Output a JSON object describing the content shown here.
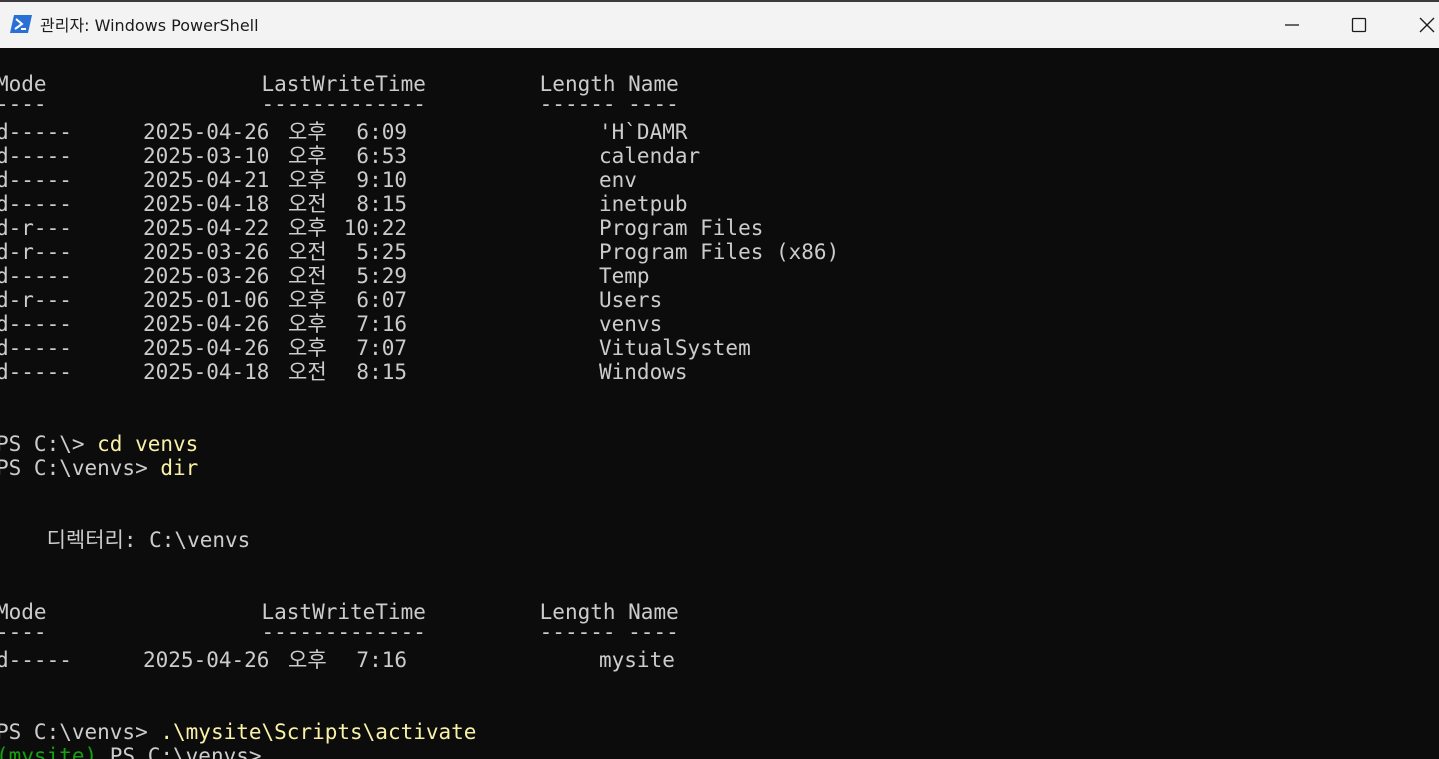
{
  "window": {
    "title": "관리자: Windows PowerShell",
    "icon": "powershell-icon",
    "controls": [
      "minimize-icon",
      "maximize-icon",
      "close-icon"
    ]
  },
  "colors": {
    "background": "#0c0c0c",
    "text": "#cccccc",
    "command": "#f9f1a5",
    "venv_prefix": "#13a10e",
    "titlebar": "#f3f3f3"
  },
  "terminal": {
    "listing1": {
      "header": "Mode                 LastWriteTime         Length Name",
      "underline": "----                 -------------         ------ ----",
      "rows": [
        {
          "mode": "d-----",
          "date": "2025-04-26",
          "ampm": "오후",
          "time": "6:09",
          "name": "'H`DAMR"
        },
        {
          "mode": "d-----",
          "date": "2025-03-10",
          "ampm": "오후",
          "time": "6:53",
          "name": "calendar"
        },
        {
          "mode": "d-----",
          "date": "2025-04-21",
          "ampm": "오후",
          "time": "9:10",
          "name": "env"
        },
        {
          "mode": "d-----",
          "date": "2025-04-18",
          "ampm": "오전",
          "time": "8:15",
          "name": "inetpub"
        },
        {
          "mode": "d-r---",
          "date": "2025-04-22",
          "ampm": "오후",
          "time": "10:22",
          "name": "Program Files"
        },
        {
          "mode": "d-r---",
          "date": "2025-03-26",
          "ampm": "오전",
          "time": "5:25",
          "name": "Program Files (x86)"
        },
        {
          "mode": "d-----",
          "date": "2025-03-26",
          "ampm": "오전",
          "time": "5:29",
          "name": "Temp"
        },
        {
          "mode": "d-r---",
          "date": "2025-01-06",
          "ampm": "오후",
          "time": "6:07",
          "name": "Users"
        },
        {
          "mode": "d-----",
          "date": "2025-04-26",
          "ampm": "오후",
          "time": "7:16",
          "name": "venvs"
        },
        {
          "mode": "d-----",
          "date": "2025-04-26",
          "ampm": "오후",
          "time": "7:07",
          "name": "VitualSystem"
        },
        {
          "mode": "d-----",
          "date": "2025-04-18",
          "ampm": "오전",
          "time": "8:15",
          "name": "Windows"
        }
      ]
    },
    "prompt1": "PS C:\\> ",
    "command1": "cd venvs",
    "prompt2": "PS C:\\venvs> ",
    "command2": "dir",
    "directory_label": "    디렉터리: C:\\venvs",
    "listing2": {
      "header": "Mode                 LastWriteTime         Length Name",
      "underline": "----                 -------------         ------ ----",
      "rows": [
        {
          "mode": "d-----",
          "date": "2025-04-26",
          "ampm": "오후",
          "time": "7:16",
          "name": "mysite"
        }
      ]
    },
    "prompt3": "PS C:\\venvs> ",
    "command3": ".\\mysite\\Scripts\\activate",
    "venv_prefix": "(mysite) ",
    "prompt4": "PS C:\\venvs> "
  }
}
